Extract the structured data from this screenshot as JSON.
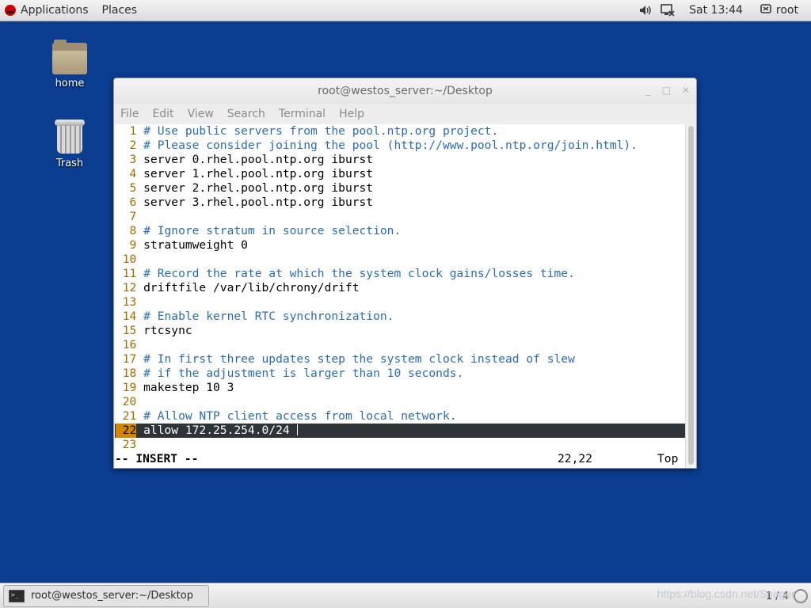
{
  "top_panel": {
    "applications": "Applications",
    "places": "Places",
    "clock": "Sat 13:44",
    "user": "root"
  },
  "desktop": {
    "icons": [
      {
        "label": "home"
      },
      {
        "label": "Trash"
      }
    ]
  },
  "window": {
    "title": "root@westos_server:~/Desktop",
    "menu": [
      "File",
      "Edit",
      "View",
      "Search",
      "Terminal",
      "Help"
    ]
  },
  "editor": {
    "lines": [
      {
        "n": "1",
        "text": "# Use public servers from the pool.ntp.org project."
      },
      {
        "n": "2",
        "text": "# Please consider joining the pool (http://www.pool.ntp.org/join.html)."
      },
      {
        "n": "3",
        "text": "server 0.rhel.pool.ntp.org iburst"
      },
      {
        "n": "4",
        "text": "server 1.rhel.pool.ntp.org iburst"
      },
      {
        "n": "5",
        "text": "server 2.rhel.pool.ntp.org iburst"
      },
      {
        "n": "6",
        "text": "server 3.rhel.pool.ntp.org iburst"
      },
      {
        "n": "7",
        "text": ""
      },
      {
        "n": "8",
        "text": "# Ignore stratum in source selection."
      },
      {
        "n": "9",
        "text": "stratumweight 0"
      },
      {
        "n": "10",
        "text": ""
      },
      {
        "n": "11",
        "text": "# Record the rate at which the system clock gains/losses time."
      },
      {
        "n": "12",
        "text": "driftfile /var/lib/chrony/drift"
      },
      {
        "n": "13",
        "text": ""
      },
      {
        "n": "14",
        "text": "# Enable kernel RTC synchronization."
      },
      {
        "n": "15",
        "text": "rtcsync"
      },
      {
        "n": "16",
        "text": ""
      },
      {
        "n": "17",
        "text": "# In first three updates step the system clock instead of slew"
      },
      {
        "n": "18",
        "text": "# if the adjustment is larger than 10 seconds."
      },
      {
        "n": "19",
        "text": "makestep 10 3"
      },
      {
        "n": "20",
        "text": ""
      },
      {
        "n": "21",
        "text": "# Allow NTP client access from local network."
      },
      {
        "n": "22",
        "text": "allow 172.25.254.0/24"
      },
      {
        "n": "23",
        "text": ""
      }
    ],
    "current_line": "22",
    "status_mode": "-- INSERT --",
    "status_position": "22,22",
    "status_scroll": "Top"
  },
  "taskbar": {
    "task_label": "root@westos_server:~/Desktop",
    "workspace": "1 / 4",
    "watermark": "https://blog.csdn.net/Snager"
  }
}
